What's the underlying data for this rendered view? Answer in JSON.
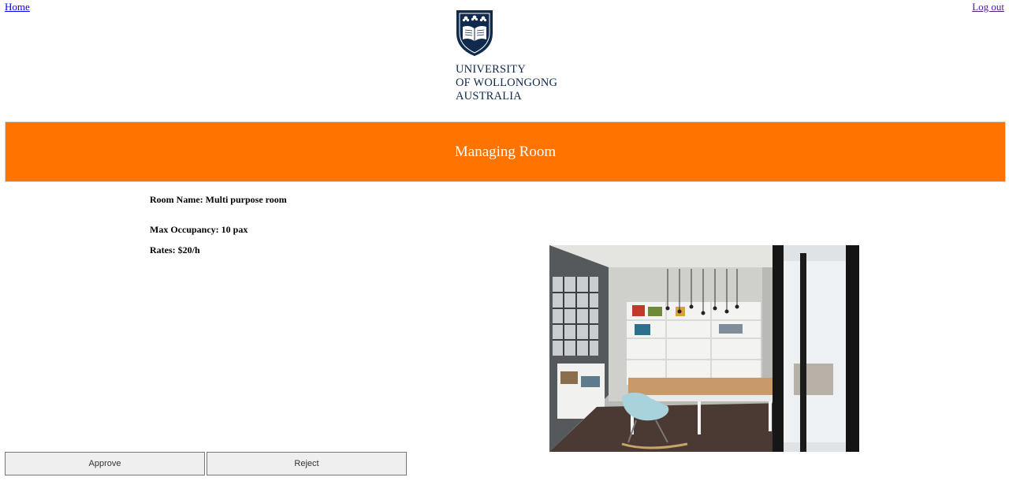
{
  "nav": {
    "home_label": "Home",
    "logout_label": "Log out"
  },
  "logo": {
    "lines": [
      "UNIVERSITY",
      "OF WOLLONGONG",
      "AUSTRALIA"
    ]
  },
  "banner": {
    "title": "Managing Room"
  },
  "room": {
    "name_line": "Room Name: Multi purpose room",
    "occupancy_line": "Max Occupancy: 10 pax",
    "rates_line": "Rates: $20/h"
  },
  "actions": {
    "approve_label": "Approve",
    "reject_label": "Reject"
  },
  "colors": {
    "banner": "#ff7300",
    "logo_navy": "#0f2a4d"
  }
}
